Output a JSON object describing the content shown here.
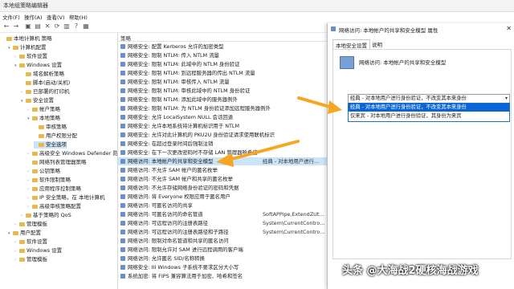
{
  "window": {
    "title": "本地组策略编辑器"
  },
  "menu": [
    "文件(F)",
    "操作(A)",
    "查看(V)",
    "帮助(H)"
  ],
  "tree": [
    {
      "label": "本地计算机 策略",
      "indent": 0,
      "chev": ""
    },
    {
      "label": "计算机配置",
      "indent": 1,
      "chev": "▾"
    },
    {
      "label": "软件设置",
      "indent": 2,
      "chev": "›"
    },
    {
      "label": "Windows 设置",
      "indent": 2,
      "chev": "▾"
    },
    {
      "label": "域名解析策略",
      "indent": 3,
      "chev": ""
    },
    {
      "label": "脚本(启动/关机)",
      "indent": 3,
      "chev": ""
    },
    {
      "label": "已部署的打印机",
      "indent": 3,
      "chev": "›"
    },
    {
      "label": "安全设置",
      "indent": 3,
      "chev": "▾"
    },
    {
      "label": "帐户策略",
      "indent": 4,
      "chev": "›"
    },
    {
      "label": "本地策略",
      "indent": 4,
      "chev": "▾"
    },
    {
      "label": "审核策略",
      "indent": 5,
      "chev": ""
    },
    {
      "label": "用户权限分配",
      "indent": 5,
      "chev": ""
    },
    {
      "label": "安全选项",
      "indent": 5,
      "chev": "",
      "selected": true
    },
    {
      "label": "高级安全 Windows Defender 防火墙",
      "indent": 4,
      "chev": "›"
    },
    {
      "label": "网络列表管理器策略",
      "indent": 4,
      "chev": ""
    },
    {
      "label": "公钥策略",
      "indent": 4,
      "chev": "›"
    },
    {
      "label": "软件限制策略",
      "indent": 4,
      "chev": "›"
    },
    {
      "label": "应用程序控制策略",
      "indent": 4,
      "chev": "›"
    },
    {
      "label": "IP 安全策略，在 本地计算机",
      "indent": 4,
      "chev": "›"
    },
    {
      "label": "高级审核策略配置",
      "indent": 4,
      "chev": "›"
    },
    {
      "label": "基于策略的 QoS",
      "indent": 3,
      "chev": "›"
    },
    {
      "label": "管理模板",
      "indent": 2,
      "chev": "›"
    },
    {
      "label": "用户配置",
      "indent": 1,
      "chev": "▾"
    },
    {
      "label": "软件设置",
      "indent": 2,
      "chev": "›"
    },
    {
      "label": "Windows 设置",
      "indent": 2,
      "chev": "›"
    },
    {
      "label": "管理模板",
      "indent": 2,
      "chev": "›"
    }
  ],
  "list": {
    "header_policy": "策略",
    "rows": [
      {
        "name": "网络安全: 配置 Kerberos 允许的加密类型",
        "value": ""
      },
      {
        "name": "网络安全: 限制 NTLM: 传入 NTLM 流量",
        "value": ""
      },
      {
        "name": "网络安全: 限制 NTLM: 此域中的 NTLM 身份验证",
        "value": ""
      },
      {
        "name": "网络安全: 限制 NTLM: 到远程服务器的传出 NTLM 流量",
        "value": ""
      },
      {
        "name": "网络安全: 限制 NTLM: 审核传入 NTLM 流量",
        "value": ""
      },
      {
        "name": "网络安全: 限制 NTLM: 审核此域中的 NTLM 身份验证",
        "value": ""
      },
      {
        "name": "网络安全: 限制 NTLM: 添加此域中的服务器例外",
        "value": ""
      },
      {
        "name": "网络安全: 限制 NTLM: 为 NTLM 身份验证添加远程服务器例外",
        "value": ""
      },
      {
        "name": "网络安全: 允许 LocalSystem NULL 会话回退",
        "value": ""
      },
      {
        "name": "网络安全: 允许本地系统将计算机标识用于 NTLM",
        "value": ""
      },
      {
        "name": "网络安全: 允许对此计算机的 PKU2U 身份验证请求使用联机标识",
        "value": ""
      },
      {
        "name": "网络安全: 在超过登录时间后强制注销",
        "value": ""
      },
      {
        "name": "网络安全: 在下一次更改密码时不存储 LAN 管理器哈希值",
        "value": ""
      },
      {
        "name": "网络访问: 本地帐户的共享和安全模型",
        "value": "经典 - 对本地用户进行...",
        "selected": true
      },
      {
        "name": "网络访问: 不允许 SAM 帐户的匿名枚举",
        "value": ""
      },
      {
        "name": "网络访问: 不允许 SAM 帐户和共享的匿名枚举",
        "value": ""
      },
      {
        "name": "网络访问: 不允许存储网络身份验证的密码和凭据",
        "value": ""
      },
      {
        "name": "网络访问: 将 Everyone 权限应用于匿名用户",
        "value": ""
      },
      {
        "name": "网络访问: 可匿名访问的共享",
        "value": ""
      },
      {
        "name": "网络访问: 可匿名访问的命名管道",
        "value": ""
      },
      {
        "name": "网络访问: 可远程访问的注册表路径",
        "value": "System\\CurrentContro..."
      },
      {
        "name": "网络访问: 可远程访问的注册表路径和子路径",
        "value": "System\\CurrentContro..."
      },
      {
        "name": "网络访问: 限制对命名管道和共享的匿名访问",
        "value": ""
      },
      {
        "name": "网络访问: 限制允许对 SAM 进行远程调用的客户端",
        "value": ""
      },
      {
        "name": "网络访问: 允许匿名 SID/名称转换",
        "value": ""
      },
      {
        "name": "网络安全: III Windows 子系统不要求区分大小写",
        "value": ""
      },
      {
        "name": "系统加密: 将 FIPS 兼容算法用于加密、哈希和签名",
        "value": ""
      }
    ]
  },
  "list_partial_values": [
    {
      "row": 19,
      "value": "SoftAPPipe,ExtendZUt..."
    },
    {
      "row": 12,
      "value": ""
    }
  ],
  "dialog": {
    "title": "网络访问: 本地帐户的共享和安全模型 属性",
    "tabs": [
      "本地安全设置",
      "说明"
    ],
    "policy_name": "网络访问: 本地帐户的共享和安全模型",
    "selected_value": "经典 - 对本地用户进行身份验证，不改变其本来身份",
    "options": [
      "经典 - 对本地用户进行身份验证，不改变其本来身份",
      "仅来宾 - 对本地用户进行身份验证，其身份为来宾"
    ]
  },
  "watermark": "头条 @大海战2硬核海战游戏",
  "colors": {
    "selection": "#cce4f7",
    "highlight": "#0a64d6",
    "arrow": "#f5a623"
  }
}
